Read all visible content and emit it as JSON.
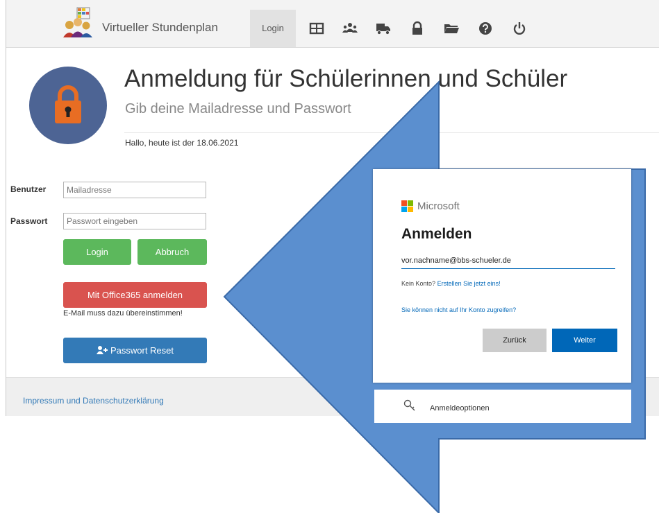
{
  "navbar": {
    "brand": "Virtueller Stundenplan",
    "login_label": "Login",
    "icons": [
      "table-icon",
      "users-icon",
      "truck-icon",
      "lock-icon",
      "folder-icon",
      "help-icon",
      "power-icon"
    ]
  },
  "header": {
    "title": "Anmeldung für Schülerinnen und Schüler",
    "subtitle": "Gib deine Mailadresse und Passwort",
    "greeting": "Hallo, heute ist der 18.06.2021"
  },
  "form": {
    "user_label": "Benutzer",
    "user_placeholder": "Mailadresse",
    "password_label": "Passwort",
    "password_placeholder": "Passwort eingeben",
    "login_button": "Login",
    "cancel_button": "Abbruch",
    "office_button": "Mit Office365 anmelden",
    "office_hint": "E-Mail muss dazu übereinstimmen!",
    "reset_button": "Passwort Reset"
  },
  "footer": {
    "link": "Impressum und Datenschutzerklärung"
  },
  "ms_dialog": {
    "brand": "Microsoft",
    "title": "Anmelden",
    "email_value": "vor.nachname@bbs-schueler.de",
    "no_account_text": "Kein Konto?",
    "create_link": "Erstellen Sie jetzt eins!",
    "no_access_link": "Sie können nicht auf Ihr Konto zugreifen?",
    "back_button": "Zurück",
    "next_button": "Weiter",
    "options_label": "Anmeldeoptionen"
  },
  "colors": {
    "arrow_fill": "#5b8fcf",
    "arrow_stroke": "#3a6aa8",
    "green": "#5cb85c",
    "red": "#d9534f",
    "blue": "#337ab7",
    "lock_circle": "#4d6494",
    "ms_blue": "#0067b8"
  }
}
